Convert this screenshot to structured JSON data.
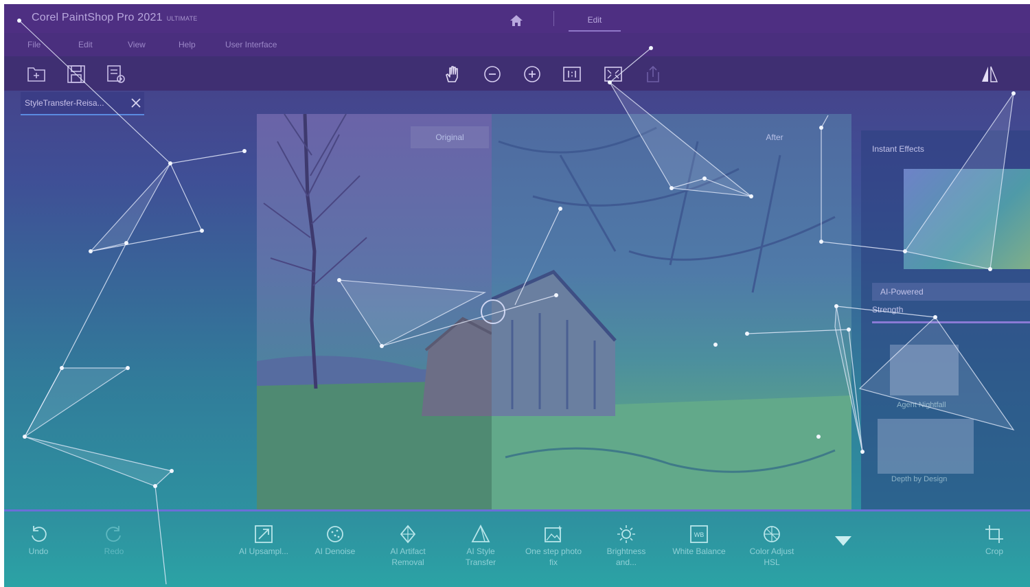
{
  "app": {
    "title": "Corel PaintShop Pro 2021",
    "edition": "ULTIMATE",
    "mode_tab": "Edit"
  },
  "menu": [
    "File",
    "Edit",
    "View",
    "Help",
    "User Interface"
  ],
  "toolbar": {
    "left_icons": [
      "new-file-icon",
      "save-icon",
      "save-as-icon"
    ],
    "center_icons": [
      "pan-hand-icon",
      "zoom-out-icon",
      "zoom-in-icon",
      "actual-size-icon",
      "fit-window-icon",
      "share-icon"
    ],
    "right_icons": [
      "compare-icon"
    ]
  },
  "document_tab": {
    "label": "StyleTransfer-Reisa..."
  },
  "canvas": {
    "before_label": "Original",
    "after_label": "After"
  },
  "right_panel": {
    "title": "Instant Effects",
    "dropdown_value": "AI-Powered",
    "strength_label": "Strength",
    "thumbs": [
      "Agent Nightfall",
      "Depth by Design"
    ]
  },
  "bottom_bar": {
    "items": [
      {
        "label": "Undo",
        "icon": "undo-icon"
      },
      {
        "label": "Redo",
        "icon": "redo-icon"
      },
      {
        "label": "AI Upsampl...",
        "icon": "ai-upsampling-icon"
      },
      {
        "label": "AI Denoise",
        "icon": "ai-denoise-icon"
      },
      {
        "label": "AI Artifact Removal",
        "icon": "ai-artifact-removal-icon"
      },
      {
        "label": "AI Style Transfer",
        "icon": "ai-style-transfer-icon"
      },
      {
        "label": "One step photo fix",
        "icon": "one-step-photo-fix-icon"
      },
      {
        "label": "Brightness and...",
        "icon": "brightness-icon"
      },
      {
        "label": "White Balance",
        "icon": "white-balance-icon"
      },
      {
        "label": "Color Adjust HSL",
        "icon": "color-adjust-hsl-icon"
      },
      {
        "label": "Crop",
        "icon": "crop-icon"
      }
    ],
    "more_icon": "chevron-down-icon"
  },
  "colors": {
    "title_bar": "#4e2f82",
    "toolbar": "#3f2f72",
    "accent_line": "#6b6ed8",
    "bottom_bar": "#2ba3a5"
  }
}
